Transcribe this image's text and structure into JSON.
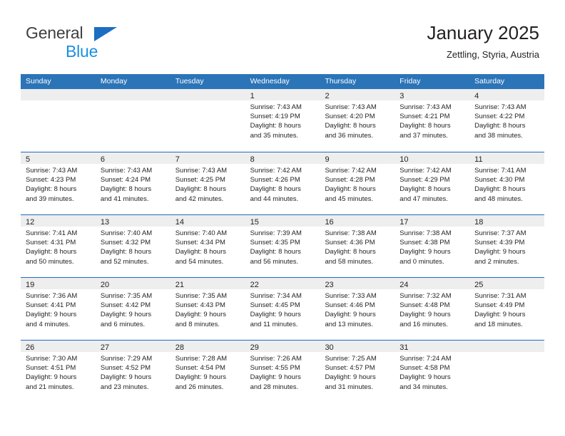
{
  "brand": {
    "name_part1": "General",
    "name_part2": "Blue",
    "triangle_icon": "blue-triangle-icon"
  },
  "header": {
    "title": "January 2025",
    "subtitle": "Zettling, Styria, Austria"
  },
  "colors": {
    "header_blue": "#2b74b8",
    "row_divider_blue": "#1b6ec2",
    "day_band_gray": "#eeeeee",
    "brand_blue": "#1b8fe0",
    "text": "#231f20"
  },
  "weekdays": [
    "Sunday",
    "Monday",
    "Tuesday",
    "Wednesday",
    "Thursday",
    "Friday",
    "Saturday"
  ],
  "weeks": [
    [
      {
        "day": "",
        "empty": true,
        "sunrise": "",
        "sunset": "",
        "daylight1": "",
        "daylight2": ""
      },
      {
        "day": "",
        "empty": true,
        "sunrise": "",
        "sunset": "",
        "daylight1": "",
        "daylight2": ""
      },
      {
        "day": "",
        "empty": true,
        "sunrise": "",
        "sunset": "",
        "daylight1": "",
        "daylight2": ""
      },
      {
        "day": "1",
        "empty": false,
        "sunrise": "Sunrise: 7:43 AM",
        "sunset": "Sunset: 4:19 PM",
        "daylight1": "Daylight: 8 hours",
        "daylight2": "and 35 minutes."
      },
      {
        "day": "2",
        "empty": false,
        "sunrise": "Sunrise: 7:43 AM",
        "sunset": "Sunset: 4:20 PM",
        "daylight1": "Daylight: 8 hours",
        "daylight2": "and 36 minutes."
      },
      {
        "day": "3",
        "empty": false,
        "sunrise": "Sunrise: 7:43 AM",
        "sunset": "Sunset: 4:21 PM",
        "daylight1": "Daylight: 8 hours",
        "daylight2": "and 37 minutes."
      },
      {
        "day": "4",
        "empty": false,
        "sunrise": "Sunrise: 7:43 AM",
        "sunset": "Sunset: 4:22 PM",
        "daylight1": "Daylight: 8 hours",
        "daylight2": "and 38 minutes."
      }
    ],
    [
      {
        "day": "5",
        "empty": false,
        "sunrise": "Sunrise: 7:43 AM",
        "sunset": "Sunset: 4:23 PM",
        "daylight1": "Daylight: 8 hours",
        "daylight2": "and 39 minutes."
      },
      {
        "day": "6",
        "empty": false,
        "sunrise": "Sunrise: 7:43 AM",
        "sunset": "Sunset: 4:24 PM",
        "daylight1": "Daylight: 8 hours",
        "daylight2": "and 41 minutes."
      },
      {
        "day": "7",
        "empty": false,
        "sunrise": "Sunrise: 7:43 AM",
        "sunset": "Sunset: 4:25 PM",
        "daylight1": "Daylight: 8 hours",
        "daylight2": "and 42 minutes."
      },
      {
        "day": "8",
        "empty": false,
        "sunrise": "Sunrise: 7:42 AM",
        "sunset": "Sunset: 4:26 PM",
        "daylight1": "Daylight: 8 hours",
        "daylight2": "and 44 minutes."
      },
      {
        "day": "9",
        "empty": false,
        "sunrise": "Sunrise: 7:42 AM",
        "sunset": "Sunset: 4:28 PM",
        "daylight1": "Daylight: 8 hours",
        "daylight2": "and 45 minutes."
      },
      {
        "day": "10",
        "empty": false,
        "sunrise": "Sunrise: 7:42 AM",
        "sunset": "Sunset: 4:29 PM",
        "daylight1": "Daylight: 8 hours",
        "daylight2": "and 47 minutes."
      },
      {
        "day": "11",
        "empty": false,
        "sunrise": "Sunrise: 7:41 AM",
        "sunset": "Sunset: 4:30 PM",
        "daylight1": "Daylight: 8 hours",
        "daylight2": "and 48 minutes."
      }
    ],
    [
      {
        "day": "12",
        "empty": false,
        "sunrise": "Sunrise: 7:41 AM",
        "sunset": "Sunset: 4:31 PM",
        "daylight1": "Daylight: 8 hours",
        "daylight2": "and 50 minutes."
      },
      {
        "day": "13",
        "empty": false,
        "sunrise": "Sunrise: 7:40 AM",
        "sunset": "Sunset: 4:32 PM",
        "daylight1": "Daylight: 8 hours",
        "daylight2": "and 52 minutes."
      },
      {
        "day": "14",
        "empty": false,
        "sunrise": "Sunrise: 7:40 AM",
        "sunset": "Sunset: 4:34 PM",
        "daylight1": "Daylight: 8 hours",
        "daylight2": "and 54 minutes."
      },
      {
        "day": "15",
        "empty": false,
        "sunrise": "Sunrise: 7:39 AM",
        "sunset": "Sunset: 4:35 PM",
        "daylight1": "Daylight: 8 hours",
        "daylight2": "and 56 minutes."
      },
      {
        "day": "16",
        "empty": false,
        "sunrise": "Sunrise: 7:38 AM",
        "sunset": "Sunset: 4:36 PM",
        "daylight1": "Daylight: 8 hours",
        "daylight2": "and 58 minutes."
      },
      {
        "day": "17",
        "empty": false,
        "sunrise": "Sunrise: 7:38 AM",
        "sunset": "Sunset: 4:38 PM",
        "daylight1": "Daylight: 9 hours",
        "daylight2": "and 0 minutes."
      },
      {
        "day": "18",
        "empty": false,
        "sunrise": "Sunrise: 7:37 AM",
        "sunset": "Sunset: 4:39 PM",
        "daylight1": "Daylight: 9 hours",
        "daylight2": "and 2 minutes."
      }
    ],
    [
      {
        "day": "19",
        "empty": false,
        "sunrise": "Sunrise: 7:36 AM",
        "sunset": "Sunset: 4:41 PM",
        "daylight1": "Daylight: 9 hours",
        "daylight2": "and 4 minutes."
      },
      {
        "day": "20",
        "empty": false,
        "sunrise": "Sunrise: 7:35 AM",
        "sunset": "Sunset: 4:42 PM",
        "daylight1": "Daylight: 9 hours",
        "daylight2": "and 6 minutes."
      },
      {
        "day": "21",
        "empty": false,
        "sunrise": "Sunrise: 7:35 AM",
        "sunset": "Sunset: 4:43 PM",
        "daylight1": "Daylight: 9 hours",
        "daylight2": "and 8 minutes."
      },
      {
        "day": "22",
        "empty": false,
        "sunrise": "Sunrise: 7:34 AM",
        "sunset": "Sunset: 4:45 PM",
        "daylight1": "Daylight: 9 hours",
        "daylight2": "and 11 minutes."
      },
      {
        "day": "23",
        "empty": false,
        "sunrise": "Sunrise: 7:33 AM",
        "sunset": "Sunset: 4:46 PM",
        "daylight1": "Daylight: 9 hours",
        "daylight2": "and 13 minutes."
      },
      {
        "day": "24",
        "empty": false,
        "sunrise": "Sunrise: 7:32 AM",
        "sunset": "Sunset: 4:48 PM",
        "daylight1": "Daylight: 9 hours",
        "daylight2": "and 16 minutes."
      },
      {
        "day": "25",
        "empty": false,
        "sunrise": "Sunrise: 7:31 AM",
        "sunset": "Sunset: 4:49 PM",
        "daylight1": "Daylight: 9 hours",
        "daylight2": "and 18 minutes."
      }
    ],
    [
      {
        "day": "26",
        "empty": false,
        "sunrise": "Sunrise: 7:30 AM",
        "sunset": "Sunset: 4:51 PM",
        "daylight1": "Daylight: 9 hours",
        "daylight2": "and 21 minutes."
      },
      {
        "day": "27",
        "empty": false,
        "sunrise": "Sunrise: 7:29 AM",
        "sunset": "Sunset: 4:52 PM",
        "daylight1": "Daylight: 9 hours",
        "daylight2": "and 23 minutes."
      },
      {
        "day": "28",
        "empty": false,
        "sunrise": "Sunrise: 7:28 AM",
        "sunset": "Sunset: 4:54 PM",
        "daylight1": "Daylight: 9 hours",
        "daylight2": "and 26 minutes."
      },
      {
        "day": "29",
        "empty": false,
        "sunrise": "Sunrise: 7:26 AM",
        "sunset": "Sunset: 4:55 PM",
        "daylight1": "Daylight: 9 hours",
        "daylight2": "and 28 minutes."
      },
      {
        "day": "30",
        "empty": false,
        "sunrise": "Sunrise: 7:25 AM",
        "sunset": "Sunset: 4:57 PM",
        "daylight1": "Daylight: 9 hours",
        "daylight2": "and 31 minutes."
      },
      {
        "day": "31",
        "empty": false,
        "sunrise": "Sunrise: 7:24 AM",
        "sunset": "Sunset: 4:58 PM",
        "daylight1": "Daylight: 9 hours",
        "daylight2": "and 34 minutes."
      },
      {
        "day": "",
        "empty": true,
        "sunrise": "",
        "sunset": "",
        "daylight1": "",
        "daylight2": ""
      }
    ]
  ]
}
